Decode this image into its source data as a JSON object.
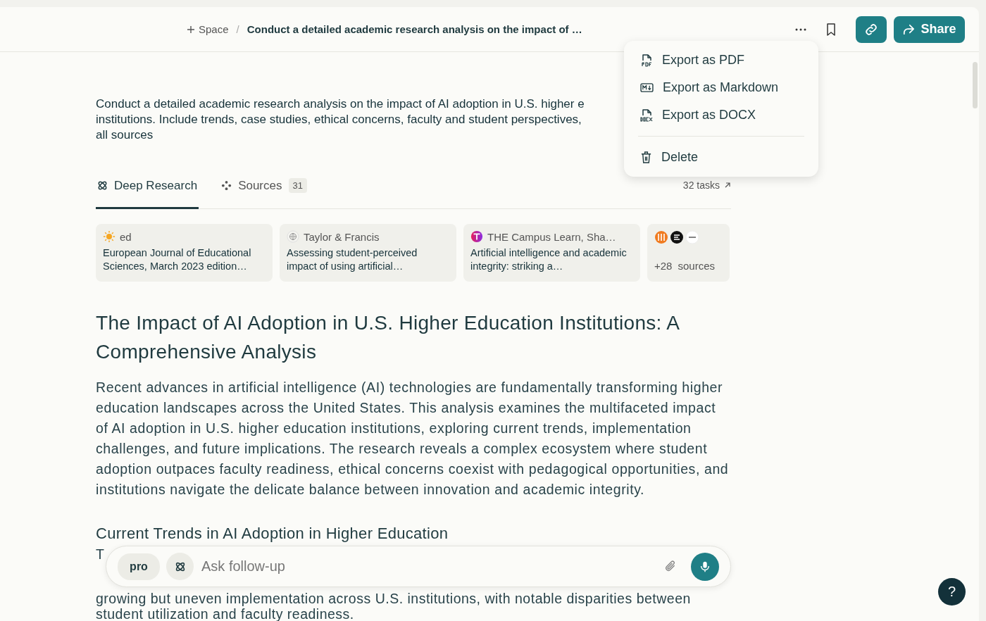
{
  "breadcrumb": {
    "space": "Space",
    "separator": "/",
    "title": "Conduct a detailed academic research analysis on the impact of …"
  },
  "share": {
    "label": "Share"
  },
  "menu": {
    "items": [
      {
        "kind": "pdf",
        "label": "Export as PDF"
      },
      {
        "kind": "markdown",
        "label": "Export as Markdown"
      },
      {
        "kind": "docx",
        "label": "Export as DOCX"
      },
      {
        "kind": "delete",
        "label": "Delete"
      }
    ]
  },
  "query": [
    "Conduct a detailed academic research analysis on the impact of AI adoption in U.S. higher e",
    "institutions. Include trends, case studies, ethical concerns, faculty and student perspectives,",
    "all sources"
  ],
  "tabs": [
    {
      "kind": "research",
      "label": "Deep Research",
      "selected": true
    },
    {
      "kind": "sources",
      "label": "Sources",
      "count": "31",
      "selected": false
    }
  ],
  "tasks": "32 tasks",
  "sources": [
    {
      "kind": "source",
      "site": "ed",
      "title": "European Journal of Educational Sciences, March 2023 edition…"
    },
    {
      "kind": "source",
      "site": "Taylor & Francis",
      "title": "Assessing student-perceived impact of using artificial…"
    },
    {
      "kind": "source",
      "site": "THE Campus Learn, Sha…",
      "title": "Artificial intelligence and academic integrity: striking a…"
    },
    {
      "kind": "more",
      "count": "+28",
      "label": "sources"
    }
  ],
  "article": {
    "title": "The Impact of AI Adoption in U.S. Higher Education Institutions: A Comprehensive Analysis",
    "intro": "Recent advances in artificial intelligence (AI) technologies are fundamentally transforming higher education landscapes across the United States. This analysis examines the multifaceted impact of AI adoption in U.S. higher education institutions, exploring current trends, implementation challenges, and future implications. The research reveals a complex ecosystem where student adoption outpaces faculty readiness, ethical concerns coexist with pedagogical opportunities, and institutions navigate the delicate balance between innovation and academic integrity.",
    "section": {
      "heading": "Current Trends in AI Adoption in Higher Education",
      "lines": [
        "T",
        "growing but uneven implementation across U.S. institutions, with notable disparities between",
        "student utilization and faculty readiness."
      ]
    }
  },
  "follow_up": {
    "mode": "pro",
    "placeholder": "Ask follow-up"
  },
  "help": "?"
}
